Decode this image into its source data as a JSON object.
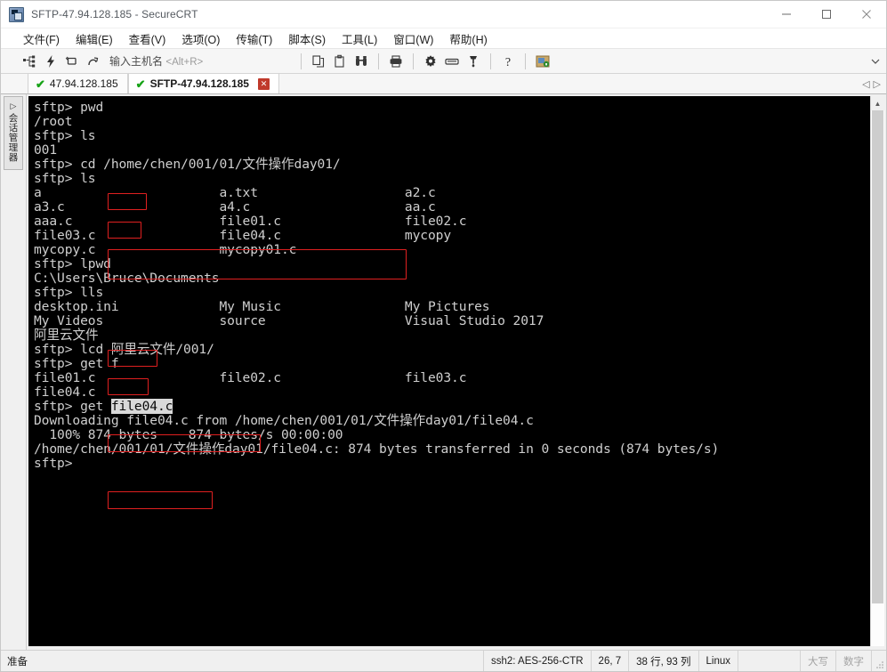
{
  "window": {
    "title": "SFTP-47.94.128.185 - SecureCRT",
    "icon": "securecrt-app-icon",
    "minimize": "–",
    "maximize": "☐",
    "close": "✕"
  },
  "menubar": {
    "items": [
      {
        "label": "文件(F)",
        "name": "menu-file"
      },
      {
        "label": "编辑(E)",
        "name": "menu-edit"
      },
      {
        "label": "查看(V)",
        "name": "menu-view"
      },
      {
        "label": "选项(O)",
        "name": "menu-options"
      },
      {
        "label": "传输(T)",
        "name": "menu-transfer"
      },
      {
        "label": "脚本(S)",
        "name": "menu-script"
      },
      {
        "label": "工具(L)",
        "name": "menu-tools"
      },
      {
        "label": "窗口(W)",
        "name": "menu-window"
      },
      {
        "label": "帮助(H)",
        "name": "menu-help"
      }
    ]
  },
  "toolbar": {
    "host_label": "输入主机名",
    "host_hotkey": "<Alt+R>",
    "icons": [
      "new-session-icon",
      "quick-connect-icon",
      "reconnect-icon",
      "disconnect-icon",
      "copy-icon",
      "paste-icon",
      "find-icon",
      "print-icon",
      "settings-gear-icon",
      "keyboard-icon",
      "key-icon",
      "help-icon",
      "secure-transfer-icon"
    ]
  },
  "tabs": {
    "items": [
      {
        "label": "47.94.128.185",
        "active": false,
        "status_icon": "green-check-icon"
      },
      {
        "label": "SFTP-47.94.128.185",
        "active": true,
        "status_icon": "green-check-icon"
      }
    ],
    "close_label": "✕",
    "nav_prev": "◁",
    "nav_next": "▷"
  },
  "sidebar": {
    "session_manager_label": "会话管理器",
    "expand_arrow": "❙▷"
  },
  "terminal": {
    "lines": [
      "sftp> pwd",
      "/root",
      "sftp> ls",
      "001",
      "sftp> cd /home/chen/001/01/文件操作day01/",
      "sftp> ls",
      "a                       a.txt                   a2.c",
      "a3.c                    a4.c                    aa.c",
      "aaa.c                   file01.c                file02.c",
      "file03.c                file04.c                mycopy",
      "mycopy.c                mycopy01.c",
      "sftp> lpwd",
      "C:\\Users\\Bruce\\Documents",
      "sftp> lls",
      "desktop.ini             My Music                My Pictures",
      "My Videos               source                  Visual Studio 2017",
      "阿里云文件",
      "sftp> lcd 阿里云文件/001/",
      "sftp> get f",
      "file01.c                file02.c                file03.c",
      "file04.c",
      "sftp> get file04.c",
      "Downloading file04.c from /home/chen/001/01/文件操作day01/file04.c",
      "  100% 874 bytes    874 bytes/s 00:00:00",
      "/home/chen/001/01/文件操作day01/file04.c: 874 bytes transferred in 0 seconds (874 bytes/s)",
      "sftp> "
    ],
    "selection_text": "file04.c",
    "annotation_color": "#e02020",
    "annotations": [
      {
        "name": "anno-pwd",
        "label": "pwd"
      },
      {
        "name": "anno-ls-1",
        "label": "ls"
      },
      {
        "name": "anno-cd-ls",
        "label": "cd /home/chen/001/01/文件操作day01/ + ls"
      },
      {
        "name": "anno-lpwd",
        "label": "lpwd"
      },
      {
        "name": "anno-lls",
        "label": "lls"
      },
      {
        "name": "anno-lcd",
        "label": "lcd 阿里云文件/001/"
      },
      {
        "name": "anno-get-file",
        "label": "get file04.c"
      }
    ]
  },
  "statusbar": {
    "ready": "准备",
    "cipher": "ssh2: AES-256-CTR",
    "cursor": "26,  7",
    "size": "38 行, 93 列",
    "emulation": "Linux",
    "caps": "大写",
    "num": "数字"
  }
}
